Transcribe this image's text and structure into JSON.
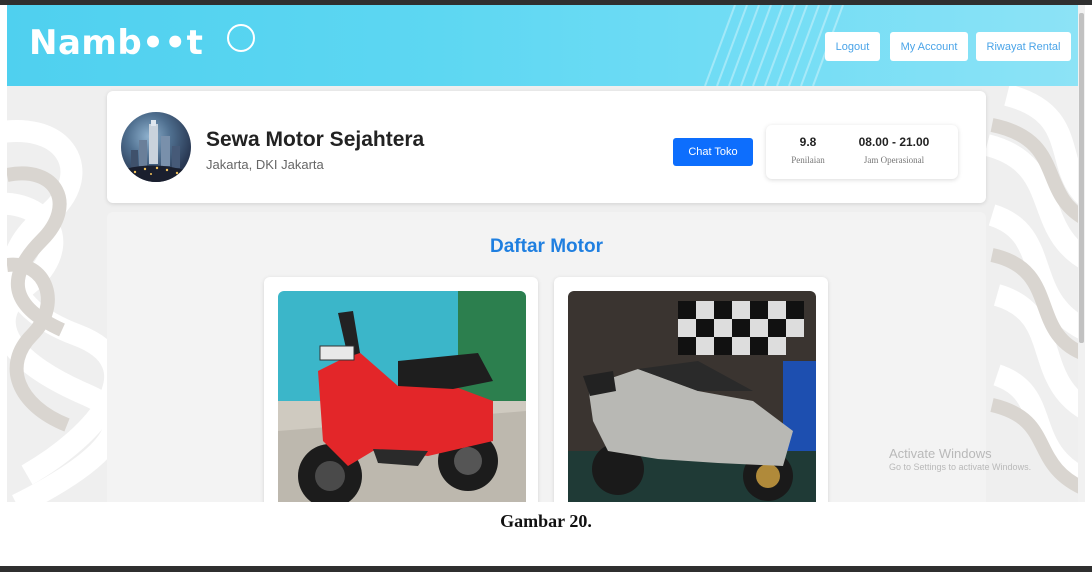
{
  "app": {
    "logo_text": "Namb••t",
    "brand_colors": {
      "navbar": "#5dd7f2",
      "primary_button": "#0d6efd",
      "title": "#1f7fe0"
    }
  },
  "nav": {
    "logout_label": "Logout",
    "account_label": "My Account",
    "history_label": "Riwayat Rental"
  },
  "store": {
    "name": "Sewa Motor Sejahtera",
    "location": "Jakarta, DKI Jakarta",
    "chat_label": "Chat Toko",
    "rating_value": "9.8",
    "rating_label": "Penilaian",
    "hours_value": "08.00 - 21.00",
    "hours_label": "Jam Operasional"
  },
  "motor_list": {
    "title": "Daftar Motor",
    "items": [
      {
        "image": "red-scooter-photo"
      },
      {
        "image": "silver-scooter-photo"
      }
    ]
  },
  "watermark": {
    "line1": "Activate Windows",
    "line2": "Go to Settings to activate Windows."
  },
  "caption": "Gambar 20."
}
